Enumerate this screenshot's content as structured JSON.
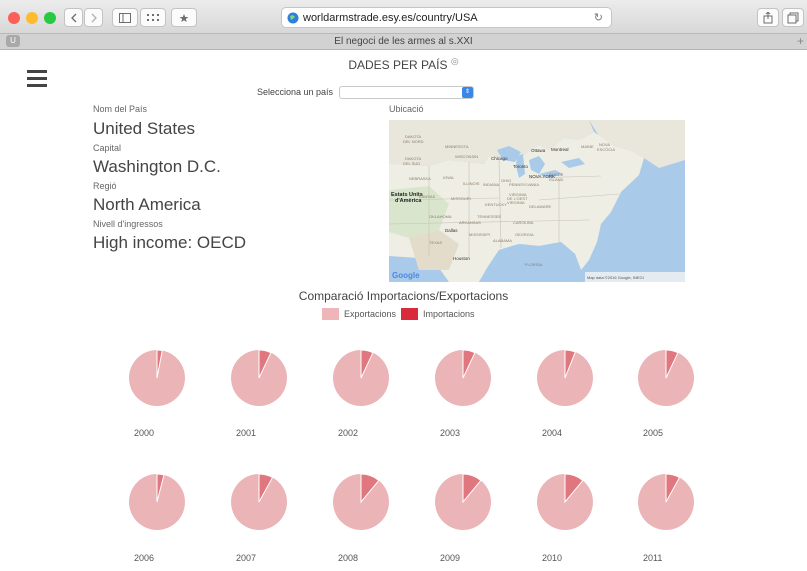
{
  "browser": {
    "url": "worldarmstrade.esy.es/country/USA",
    "tab_title": "El negoci de les armes al s.XXI",
    "tab_badge": "U"
  },
  "page": {
    "title": "DADES PER PAÍS",
    "select_label": "Selecciona un país",
    "select_value": ""
  },
  "country": {
    "name_label": "Nom del País",
    "name": "United States",
    "capital_label": "Capital",
    "capital": "Washington D.C.",
    "region_label": "Regió",
    "region": "North America",
    "income_label": "Nivell d'ingressos",
    "income": "High income: OECD"
  },
  "map": {
    "label": "Ubicació",
    "country_label_line1": "Estats Units",
    "country_label_line2": "d'Amèrica",
    "attribution": "Map data ©2016 Google, INEGI",
    "google": "Google",
    "places": [
      "Ottawa",
      "Montreal",
      "Chicago",
      "Toronto",
      "Dallas",
      "Houston",
      "NOVA YORK"
    ]
  },
  "comparison": {
    "title": "Comparació Importacions/Exportacions",
    "legend": [
      {
        "label": "Exportacions",
        "color": "#f0b5b8"
      },
      {
        "label": "Importacions",
        "color": "#d92b3a"
      }
    ],
    "colors": {
      "exports": "#ebb4b7",
      "imports": "#e0767e"
    }
  },
  "chart_data": {
    "type": "pie",
    "title": "Comparació Importacions/Exportacions",
    "series_names": [
      "Exportacions",
      "Importacions"
    ],
    "pies": [
      {
        "year": "2000",
        "exportacions": 0.97,
        "importacions": 0.03
      },
      {
        "year": "2001",
        "exportacions": 0.93,
        "importacions": 0.07
      },
      {
        "year": "2002",
        "exportacions": 0.93,
        "importacions": 0.07
      },
      {
        "year": "2003",
        "exportacions": 0.93,
        "importacions": 0.07
      },
      {
        "year": "2004",
        "exportacions": 0.94,
        "importacions": 0.06
      },
      {
        "year": "2005",
        "exportacions": 0.93,
        "importacions": 0.07
      },
      {
        "year": "2006",
        "exportacions": 0.96,
        "importacions": 0.04
      },
      {
        "year": "2007",
        "exportacions": 0.92,
        "importacions": 0.08
      },
      {
        "year": "2008",
        "exportacions": 0.89,
        "importacions": 0.11
      },
      {
        "year": "2009",
        "exportacions": 0.89,
        "importacions": 0.11
      },
      {
        "year": "2010",
        "exportacions": 0.89,
        "importacions": 0.11
      },
      {
        "year": "2011",
        "exportacions": 0.92,
        "importacions": 0.08
      }
    ]
  }
}
